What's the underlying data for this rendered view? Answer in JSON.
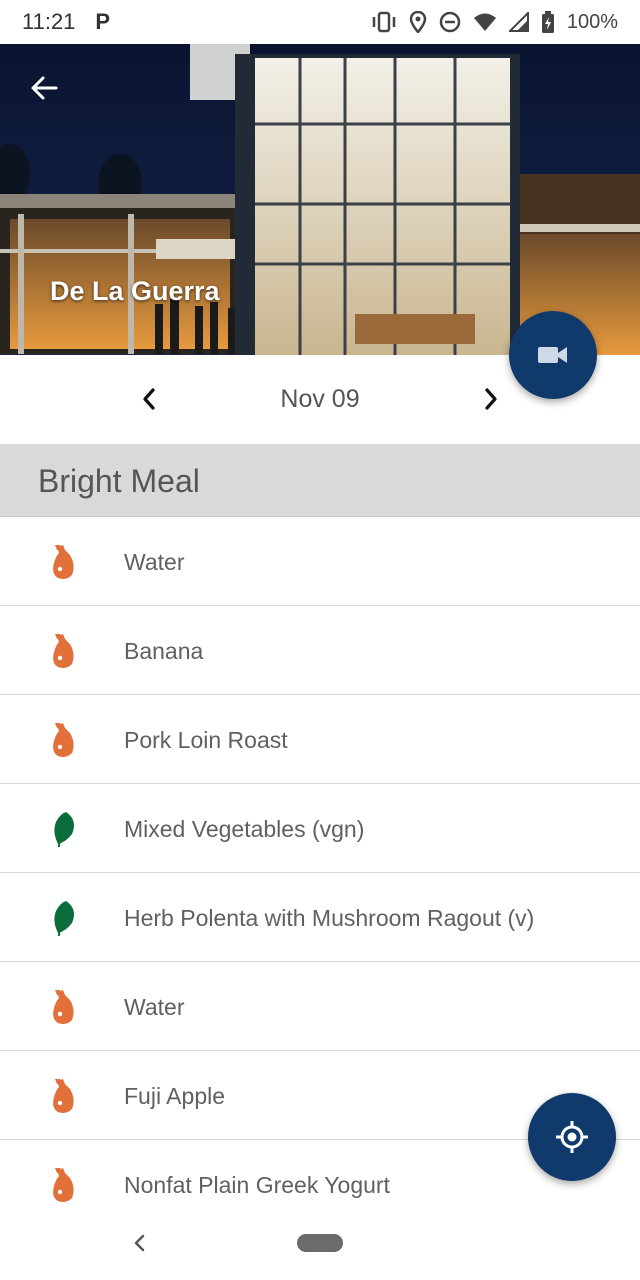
{
  "status_bar": {
    "time": "11:21",
    "app_indicator": "P",
    "battery_text": "100%",
    "icons": [
      "vibrate-icon",
      "location-icon",
      "do-not-disturb-icon",
      "wifi-icon",
      "cellular-signal-icon",
      "battery-icon"
    ]
  },
  "hero": {
    "dining_hall": "De La Guerra",
    "back_icon": "arrow-back-icon"
  },
  "camera_fab": {
    "icon": "videocam-icon"
  },
  "date_nav": {
    "date": "Nov 09",
    "prev_icon": "chevron-left-icon",
    "next_icon": "chevron-right-icon"
  },
  "meal": {
    "title": "Bright Meal",
    "items": [
      {
        "name": "Water",
        "icon": "meat-icon",
        "color": "#e2703a"
      },
      {
        "name": "Banana",
        "icon": "meat-icon",
        "color": "#e2703a"
      },
      {
        "name": "Pork Loin Roast",
        "icon": "meat-icon",
        "color": "#e2703a"
      },
      {
        "name": "Mixed Vegetables (vgn)",
        "icon": "leaf-icon",
        "color": "#0b6b3a"
      },
      {
        "name": "Herb Polenta with Mushroom Ragout (v)",
        "icon": "leaf-icon",
        "color": "#0b6b3a"
      },
      {
        "name": "Water",
        "icon": "meat-icon",
        "color": "#e2703a"
      },
      {
        "name": "Fuji Apple",
        "icon": "meat-icon",
        "color": "#e2703a"
      },
      {
        "name": "Nonfat Plain Greek Yogurt",
        "icon": "meat-icon",
        "color": "#e2703a"
      }
    ]
  },
  "locate_fab": {
    "icon": "my-location-icon"
  },
  "colors": {
    "fab": "#0f3a6b",
    "meal_header": "#d9d9d9",
    "meat_icon": "#e2703a",
    "leaf_icon": "#0b6b3a"
  }
}
